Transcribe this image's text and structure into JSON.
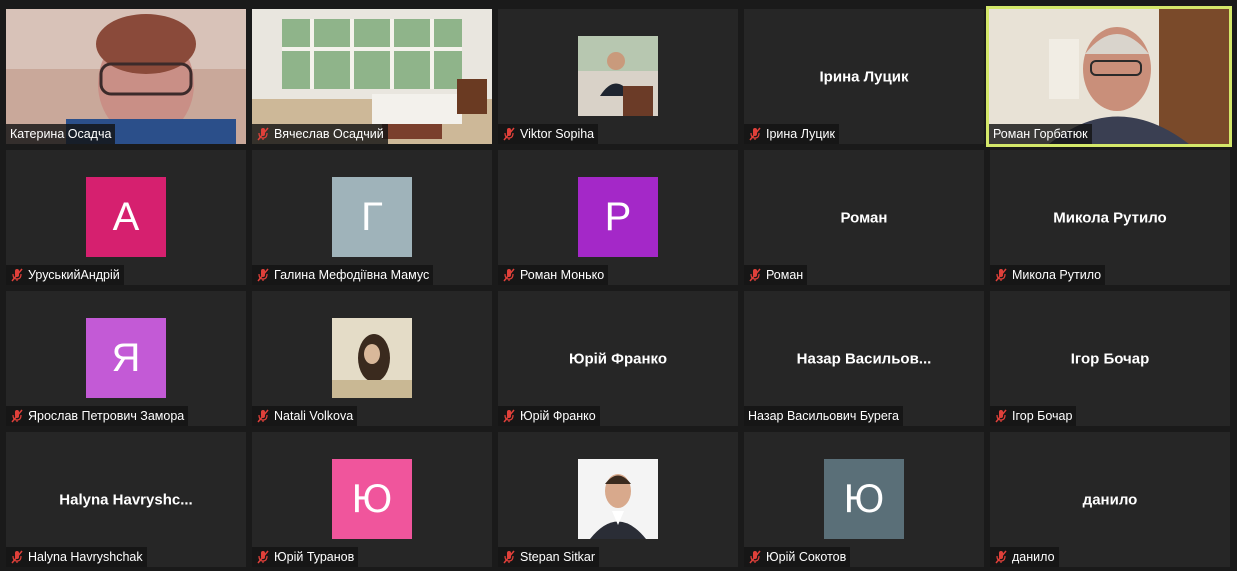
{
  "colors": {
    "tile_bg": "#262626",
    "active_speaker_border": "#d4e86a",
    "muted_mic": "#e0403a"
  },
  "tiles": [
    {
      "label": "Катерина Осадча",
      "muted": false,
      "display": "video"
    },
    {
      "label": "Вячеслав Осадчий",
      "muted": true,
      "display": "video"
    },
    {
      "label": "Viktor Sopiha",
      "muted": true,
      "display": "photo"
    },
    {
      "label": "Ірина Луцик",
      "muted": true,
      "display": "name",
      "big": "Ірина Луцик"
    },
    {
      "label": "Роман Горбатюк",
      "muted": false,
      "display": "video",
      "active": true
    },
    {
      "label": "УруськийАндрій",
      "muted": true,
      "display": "avatar",
      "initial": "А",
      "color": "#d6206f"
    },
    {
      "label": "Галина Мефодіївна Мамус",
      "muted": true,
      "display": "avatar",
      "initial": "Г",
      "color": "#9fb3ba"
    },
    {
      "label": "Роман Монько",
      "muted": true,
      "display": "avatar",
      "initial": "Р",
      "color": "#a428c8"
    },
    {
      "label": "Роман",
      "muted": true,
      "display": "name",
      "big": "Роман"
    },
    {
      "label": "Микола Рутило",
      "muted": true,
      "display": "name",
      "big": "Микола Рутило"
    },
    {
      "label": "Ярослав Петрович Замора",
      "muted": true,
      "display": "avatar",
      "initial": "Я",
      "color": "#c35ad6"
    },
    {
      "label": "Natali Volkova",
      "muted": true,
      "display": "photo"
    },
    {
      "label": "Юрій Франко",
      "muted": true,
      "display": "name",
      "big": "Юрій Франко"
    },
    {
      "label": "Назар Васильович Бурега",
      "muted": false,
      "display": "name",
      "big": "Назар  Васильов..."
    },
    {
      "label": "Ігор Бочар",
      "muted": true,
      "display": "name",
      "big": "Ігор Бочар"
    },
    {
      "label": "Halyna Havryshchak",
      "muted": true,
      "display": "name",
      "big": "Halyna  Havryshc..."
    },
    {
      "label": "Юрій Туранов",
      "muted": true,
      "display": "avatar",
      "initial": "Ю",
      "color": "#f0559c"
    },
    {
      "label": "Stepan Sitkar",
      "muted": true,
      "display": "photo"
    },
    {
      "label": "Юрій Сокотов",
      "muted": true,
      "display": "avatar",
      "initial": "Ю",
      "color": "#5a6f78"
    },
    {
      "label": "данило",
      "muted": true,
      "display": "name",
      "big": "данило"
    }
  ]
}
